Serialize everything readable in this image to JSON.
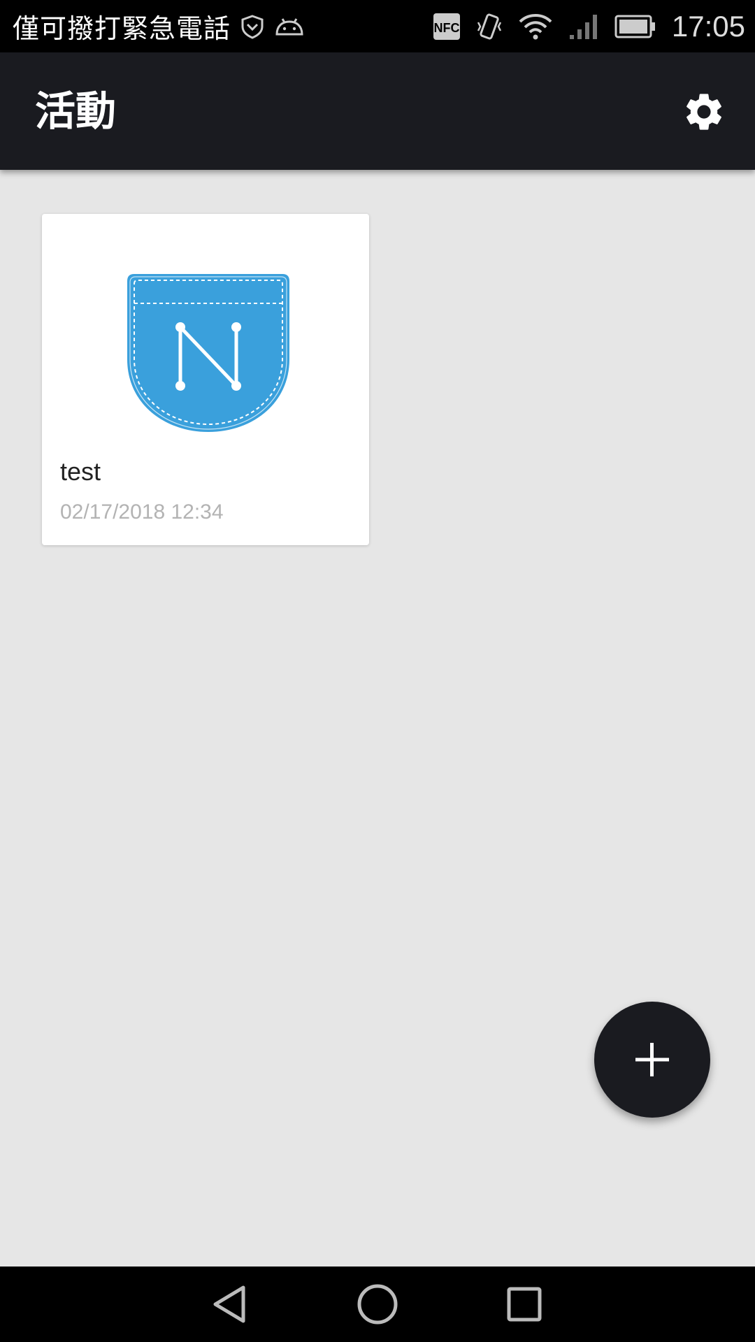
{
  "status_bar": {
    "carrier_text": "僅可撥打緊急電話",
    "time": "17:05",
    "icons": [
      "shield-icon",
      "android-icon",
      "nfc-icon",
      "vibrate-icon",
      "wifi-icon",
      "signal-icon",
      "battery-icon"
    ],
    "nfc_label": "NFC"
  },
  "app_bar": {
    "title": "活動",
    "settings_icon": "gear-icon"
  },
  "cards": [
    {
      "title": "test",
      "date": "02/17/2018 12:34",
      "image_icon": "pocket-n-logo",
      "image_color": "#3aa0dc"
    }
  ],
  "fab": {
    "icon": "plus-icon"
  },
  "nav_bar": {
    "buttons": [
      "back-icon",
      "home-icon",
      "recents-icon"
    ]
  },
  "colors": {
    "app_bar": "#1a1b20",
    "background": "#e6e6e6",
    "accent": "#3aa0dc"
  }
}
